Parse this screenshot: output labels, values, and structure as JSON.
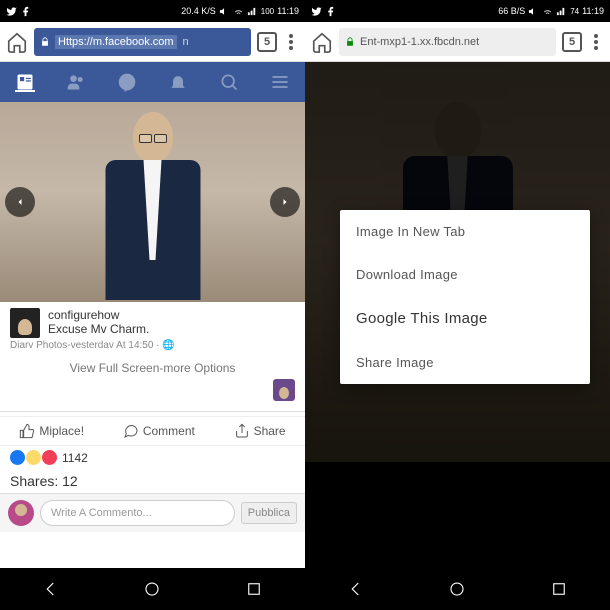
{
  "left": {
    "status": {
      "speed": "20.4 K/S",
      "time": "11:19",
      "battery": "100"
    },
    "url": "Https://m.facebook.com",
    "url_suffix": "n",
    "tab_count": "5",
    "post": {
      "author": "configurehow",
      "caption": "Excuse Mv Charm.",
      "timestamp": "Diarv Photos-vesterdav At 14:50 · ",
      "view_full": "View Full Screen-more Options"
    },
    "actions": {
      "like": "Miplace!",
      "comment": "Comment",
      "share": "Share"
    },
    "stats": {
      "reactions": "1142",
      "shares_label": "Shares:",
      "shares_count": "12"
    },
    "comment": {
      "placeholder": "Write A Commento...",
      "publish": "Pubblica"
    }
  },
  "right": {
    "status": {
      "speed": "66 B/S",
      "time": "11:19",
      "battery": "74"
    },
    "url": "Ent-mxp1-1.xx.fbcdn.net",
    "tab_count": "5",
    "menu": {
      "open": "Image In New Tab",
      "download": "Download Image",
      "google": "Google This Image",
      "share": "Share Image"
    }
  }
}
